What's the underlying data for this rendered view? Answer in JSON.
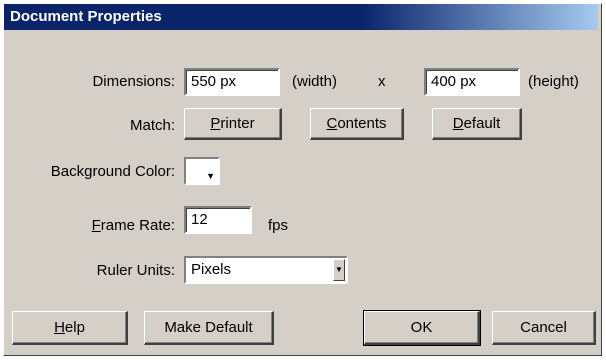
{
  "window": {
    "title": "Document Properties"
  },
  "dimensions": {
    "label": "Dimensions:",
    "width_value": "550 px",
    "width_caption": "(width)",
    "separator": "x",
    "height_value": "400 px",
    "height_caption": "(height)"
  },
  "match": {
    "label": "Match:",
    "printer_pre": "",
    "printer_key": "P",
    "printer_post": "rinter",
    "contents_pre": "",
    "contents_key": "C",
    "contents_post": "ontents",
    "default_pre": "",
    "default_key": "D",
    "default_post": "efault"
  },
  "background": {
    "label": "Background Color:",
    "color": "#ffffff",
    "arrow_icon": "chevron-down-icon"
  },
  "frame_rate": {
    "label_key": "F",
    "label_rest": "rame Rate:",
    "value": "12",
    "unit": "fps"
  },
  "ruler_units": {
    "label": "Ruler Units:",
    "selected": "Pixels"
  },
  "buttons": {
    "help_key": "H",
    "help_rest": "elp",
    "make_default": "Make Default",
    "ok": "OK",
    "cancel": "Cancel"
  },
  "colors": {
    "titlebar": "#0a246a",
    "dialog_bg": "#d4d0c8"
  }
}
